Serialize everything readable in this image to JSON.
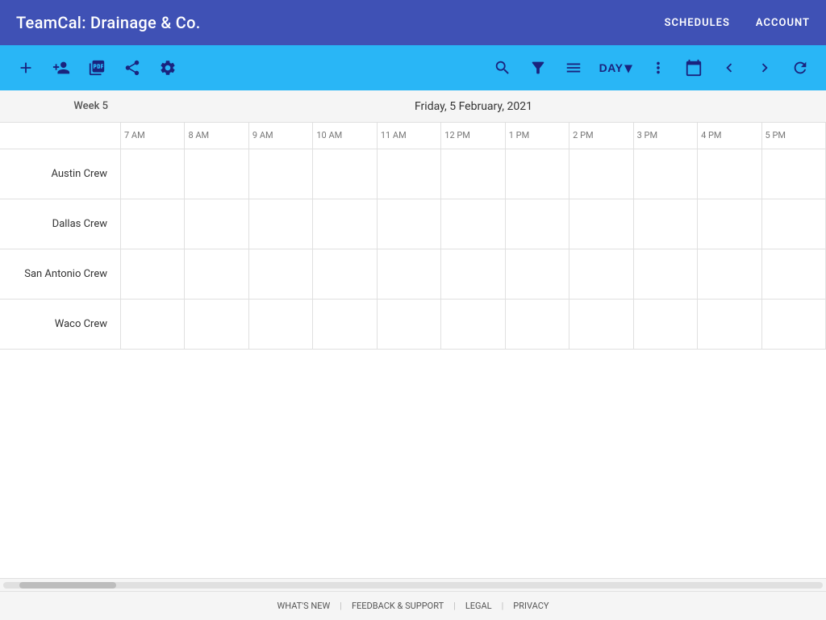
{
  "app": {
    "title": "TeamCal:  Drainage & Co."
  },
  "nav": {
    "schedules": "SCHEDULES",
    "account": "ACCOUNT"
  },
  "toolbar": {
    "add_label": "+",
    "add_person_label": "👤+",
    "pdf_label": "📄",
    "share_label": "⬆",
    "settings_label": "⚙",
    "search_label": "🔍",
    "filter_label": "▼",
    "adjust_label": "≡",
    "day_label": "DAY",
    "more_label": "⋮",
    "calendar_label": "📅",
    "prev_label": "‹",
    "next_label": "›",
    "refresh_label": "↻"
  },
  "date_bar": {
    "week_label": "Week 5",
    "date_label": "Friday, 5 February, 2021"
  },
  "time_headers": [
    "7 AM",
    "8 AM",
    "9 AM",
    "10 AM",
    "11 AM",
    "12 PM",
    "1 PM",
    "2 PM",
    "3 PM",
    "4 PM",
    "5 PM"
  ],
  "crews": [
    {
      "name": "Austin Crew"
    },
    {
      "name": "Dallas Crew"
    },
    {
      "name": "San Antonio Crew"
    },
    {
      "name": "Waco Crew"
    }
  ],
  "footer": {
    "whats_new": "WHAT'S NEW",
    "feedback": "FEEDBACK & SUPPORT",
    "legal": "LEGAL",
    "privacy": "PRIVACY"
  }
}
